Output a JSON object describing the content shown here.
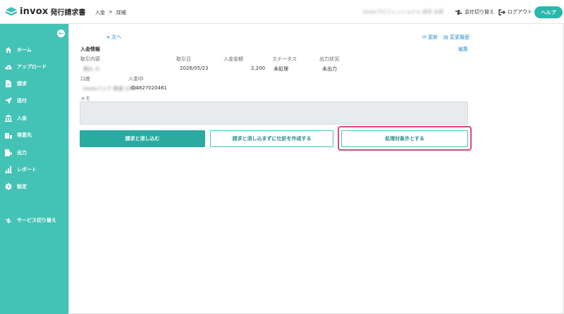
{
  "header": {
    "logo_text": "invox",
    "logo_sub": "発行請求書",
    "breadcrumb": [
      "入金",
      ">",
      "詳細"
    ],
    "company_name": "invoxプロフェッショナル 請求 太郎",
    "switch_company": "会社切り替え",
    "logout": "ログアウト",
    "help": "ヘルプ"
  },
  "sidebar": {
    "items": [
      {
        "label": "ホーム",
        "icon": "home-icon"
      },
      {
        "label": "アップロード",
        "icon": "cloud-upload-icon"
      },
      {
        "label": "請求",
        "icon": "document-icon"
      },
      {
        "label": "送付",
        "icon": "send-icon"
      },
      {
        "label": "入金",
        "icon": "bank-icon"
      },
      {
        "label": "得意先",
        "icon": "building-icon"
      },
      {
        "label": "出力",
        "icon": "export-icon"
      },
      {
        "label": "レポート",
        "icon": "chart-icon"
      },
      {
        "label": "設定",
        "icon": "gear-icon"
      },
      {
        "label": "サービス切り替え",
        "icon": "switch-icon"
      }
    ]
  },
  "main": {
    "next_link": "次へ",
    "refresh": "更新",
    "history": "変更履歴",
    "edit": "編集",
    "section_title": "入金情報",
    "fields": {
      "content_label": "取引内容",
      "content_value": "振込 カ",
      "date_label": "取引日",
      "date_value": "2026/05/23",
      "amount_label": "入金金額",
      "amount_value": "2,200",
      "status_label": "ステータス",
      "status_value": "未処理",
      "output_label": "出力状況",
      "output_value": "未出力",
      "account_label": "口座",
      "account_value": "invoxバンク 普通 1234",
      "payment_id_label": "入金ID",
      "payment_id_value": "ID4827020461",
      "memo_label": "メモ"
    },
    "buttons": {
      "reconcile": "請求と消し込む",
      "journal_only": "請求と消し込まずに仕訳を作成する",
      "exclude": "処理対象外とする"
    }
  },
  "colors": {
    "sidebar": "#43c3b6",
    "primary": "#2aaba1",
    "highlight": "#e0457b",
    "link": "#2a8fc8"
  }
}
